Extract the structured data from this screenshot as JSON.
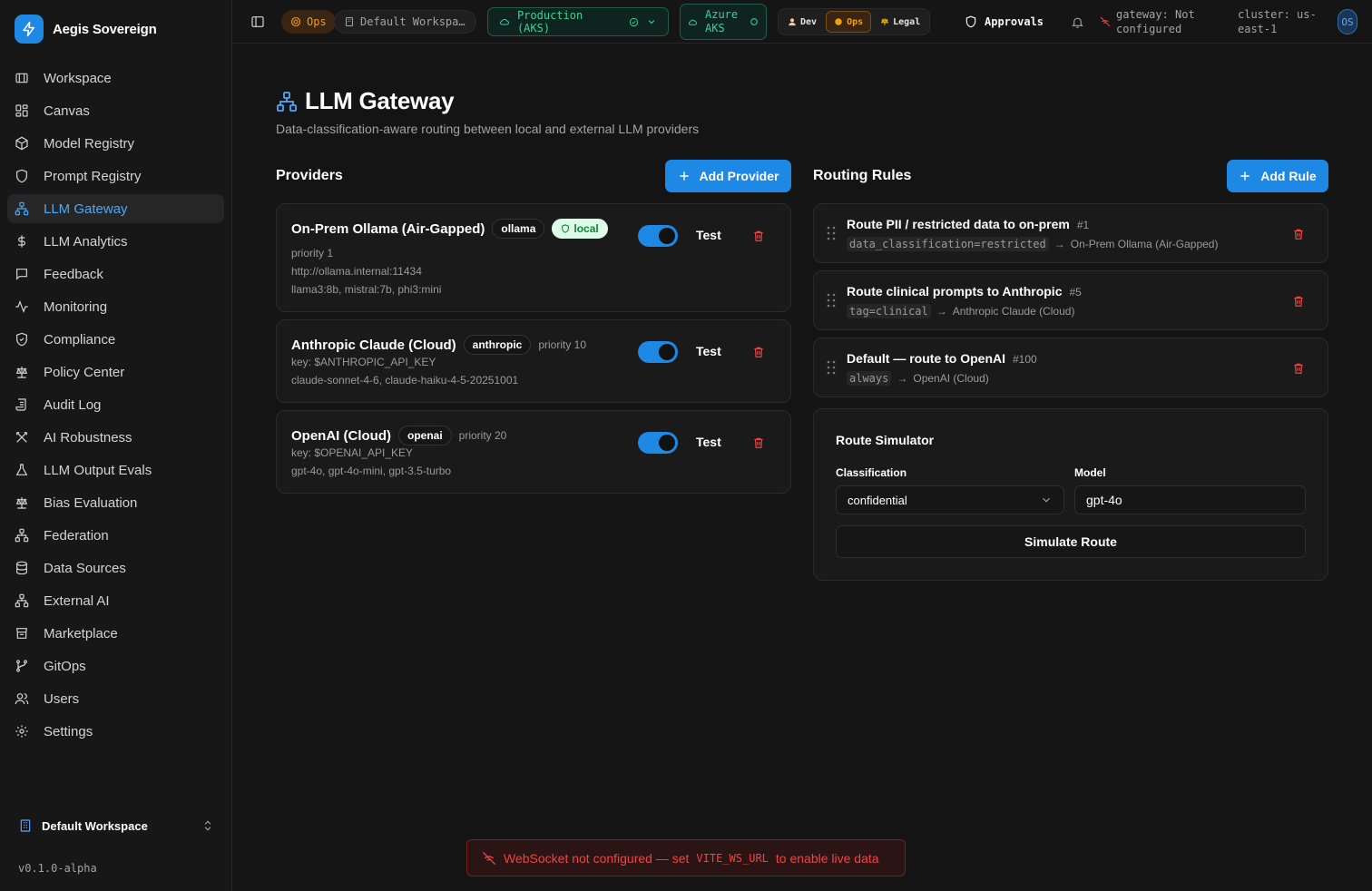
{
  "app": {
    "name": "Aegis Sovereign",
    "version": "v0.1.0-alpha",
    "workspace_switcher": "Default Workspace"
  },
  "sidebar": {
    "items": [
      {
        "label": "Workspace",
        "icon": "map-icon"
      },
      {
        "label": "Canvas",
        "icon": "grid-icon"
      },
      {
        "label": "Model Registry",
        "icon": "box-icon"
      },
      {
        "label": "Prompt Registry",
        "icon": "shield-icon"
      },
      {
        "label": "LLM Gateway",
        "icon": "network-icon",
        "active": true
      },
      {
        "label": "LLM Analytics",
        "icon": "dollar-icon"
      },
      {
        "label": "Feedback",
        "icon": "message-icon"
      },
      {
        "label": "Monitoring",
        "icon": "activity-icon"
      },
      {
        "label": "Compliance",
        "icon": "shield-check-icon"
      },
      {
        "label": "Policy Center",
        "icon": "scale-icon"
      },
      {
        "label": "Audit Log",
        "icon": "scroll-icon"
      },
      {
        "label": "AI Robustness",
        "icon": "swords-icon"
      },
      {
        "label": "LLM Output Evals",
        "icon": "flask-icon"
      },
      {
        "label": "Bias Evaluation",
        "icon": "scale-icon"
      },
      {
        "label": "Federation",
        "icon": "network-icon"
      },
      {
        "label": "Data Sources",
        "icon": "database-icon"
      },
      {
        "label": "External AI",
        "icon": "network-icon"
      },
      {
        "label": "Marketplace",
        "icon": "store-icon"
      },
      {
        "label": "GitOps",
        "icon": "git-branch-icon"
      },
      {
        "label": "Users",
        "icon": "users-icon"
      },
      {
        "label": "Settings",
        "icon": "gear-icon"
      }
    ]
  },
  "topbar": {
    "ops_badge": "Ops",
    "workspace": "Default Workspa…",
    "environment": "Production (AKS)",
    "cloud_line1": "Azure",
    "cloud_line2": "AKS",
    "roles": [
      "Dev",
      "Ops",
      "Legal"
    ],
    "approvals": "Approvals",
    "gateway_line1": "gateway: Not",
    "gateway_line2": "configured",
    "cluster_line1": "cluster: us-",
    "cluster_line2": "east-1",
    "avatar": "OS"
  },
  "page": {
    "title": "LLM Gateway",
    "subtitle": "Data-classification-aware routing between local and external LLM providers"
  },
  "providers": {
    "heading": "Providers",
    "add_label": "Add Provider",
    "test_label": "Test",
    "items": [
      {
        "name": "On-Prem Ollama (Air-Gapped)",
        "type": "ollama",
        "badge": "local",
        "priority": "priority 1",
        "endpoint": "http://ollama.internal:11434",
        "models": "llama3:8b, mistral:7b, phi3:mini",
        "enabled": true
      },
      {
        "name": "Anthropic Claude (Cloud)",
        "type": "anthropic",
        "priority": "priority 10",
        "key": "key: $ANTHROPIC_API_KEY",
        "models": "claude-sonnet-4-6, claude-haiku-4-5-20251001",
        "enabled": true
      },
      {
        "name": "OpenAI (Cloud)",
        "type": "openai",
        "priority": "priority 20",
        "key": "key: $OPENAI_API_KEY",
        "models": "gpt-4o, gpt-4o-mini, gpt-3.5-turbo",
        "enabled": true
      }
    ]
  },
  "rules": {
    "heading": "Routing Rules",
    "add_label": "Add Rule",
    "items": [
      {
        "title": "Route PII / restricted data to on-prem",
        "num": "#1",
        "cond": "data_classification=restricted",
        "target": "On-Prem Ollama (Air-Gapped)"
      },
      {
        "title": "Route clinical prompts to Anthropic",
        "num": "#5",
        "cond": "tag=clinical",
        "target": "Anthropic Claude (Cloud)"
      },
      {
        "title": "Default — route to OpenAI",
        "num": "#100",
        "cond": "always",
        "target": "OpenAI (Cloud)"
      }
    ]
  },
  "simulator": {
    "title": "Route Simulator",
    "classification_label": "Classification",
    "classification_value": "confidential",
    "model_label": "Model",
    "model_value": "gpt-4o",
    "button": "Simulate Route"
  },
  "toast": {
    "pre": "WebSocket not configured — set",
    "code": "VITE_WS_URL",
    "post": "to enable live data"
  },
  "colors": {
    "accent": "#1e88e5",
    "active_nav": "#4ea8f5",
    "ops": "#f59e0b",
    "env": "#34d399",
    "danger": "#ef4444",
    "local_badge": "#15803d"
  }
}
